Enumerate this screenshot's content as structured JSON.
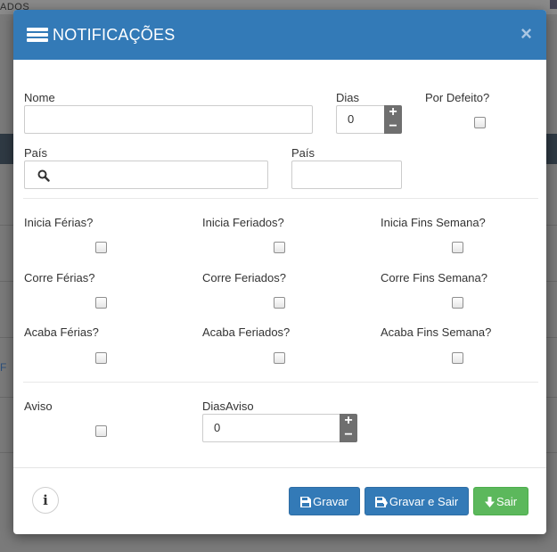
{
  "background": {
    "topbar_text": "ADOS",
    "link_text": "F"
  },
  "modal": {
    "title": "NOTIFICAÇÕES",
    "close_label": "×",
    "fields": {
      "nome": {
        "label": "Nome",
        "value": ""
      },
      "dias": {
        "label": "Dias",
        "value": "0"
      },
      "por_defeito": {
        "label": "Por Defeito?"
      },
      "pais_search": {
        "label": "País",
        "value": ""
      },
      "pais_text": {
        "label": "País",
        "value": ""
      },
      "inicia_ferias": {
        "label": "Inicia Férias?"
      },
      "inicia_feriados": {
        "label": "Inicia Feriados?"
      },
      "inicia_fins_semana": {
        "label": "Inicia Fins Semana?"
      },
      "corre_ferias": {
        "label": "Corre Férias?"
      },
      "corre_feriados": {
        "label": "Corre Feriados?"
      },
      "corre_fins_semana": {
        "label": "Corre Fins Semana?"
      },
      "acaba_ferias": {
        "label": "Acaba Férias?"
      },
      "acaba_feriados": {
        "label": "Acaba Feriados?"
      },
      "acaba_fins_semana": {
        "label": "Acaba Fins Semana?"
      },
      "aviso": {
        "label": "Aviso"
      },
      "dias_aviso": {
        "label": "DiasAviso",
        "value": "0"
      }
    },
    "stepper": {
      "plus": "+",
      "minus": "−"
    },
    "footer": {
      "info_label": "i",
      "gravar_label": "Gravar",
      "gravar_sair_label": "Gravar e Sair",
      "sair_label": "Sair"
    }
  },
  "colors": {
    "header": "#337ab7",
    "primary": "#337ab7",
    "success": "#5cb85c"
  },
  "icons": [
    "list-icon",
    "close-icon",
    "search-icon",
    "info-icon",
    "save-icon",
    "save-exit-icon",
    "download-arrow-icon"
  ]
}
